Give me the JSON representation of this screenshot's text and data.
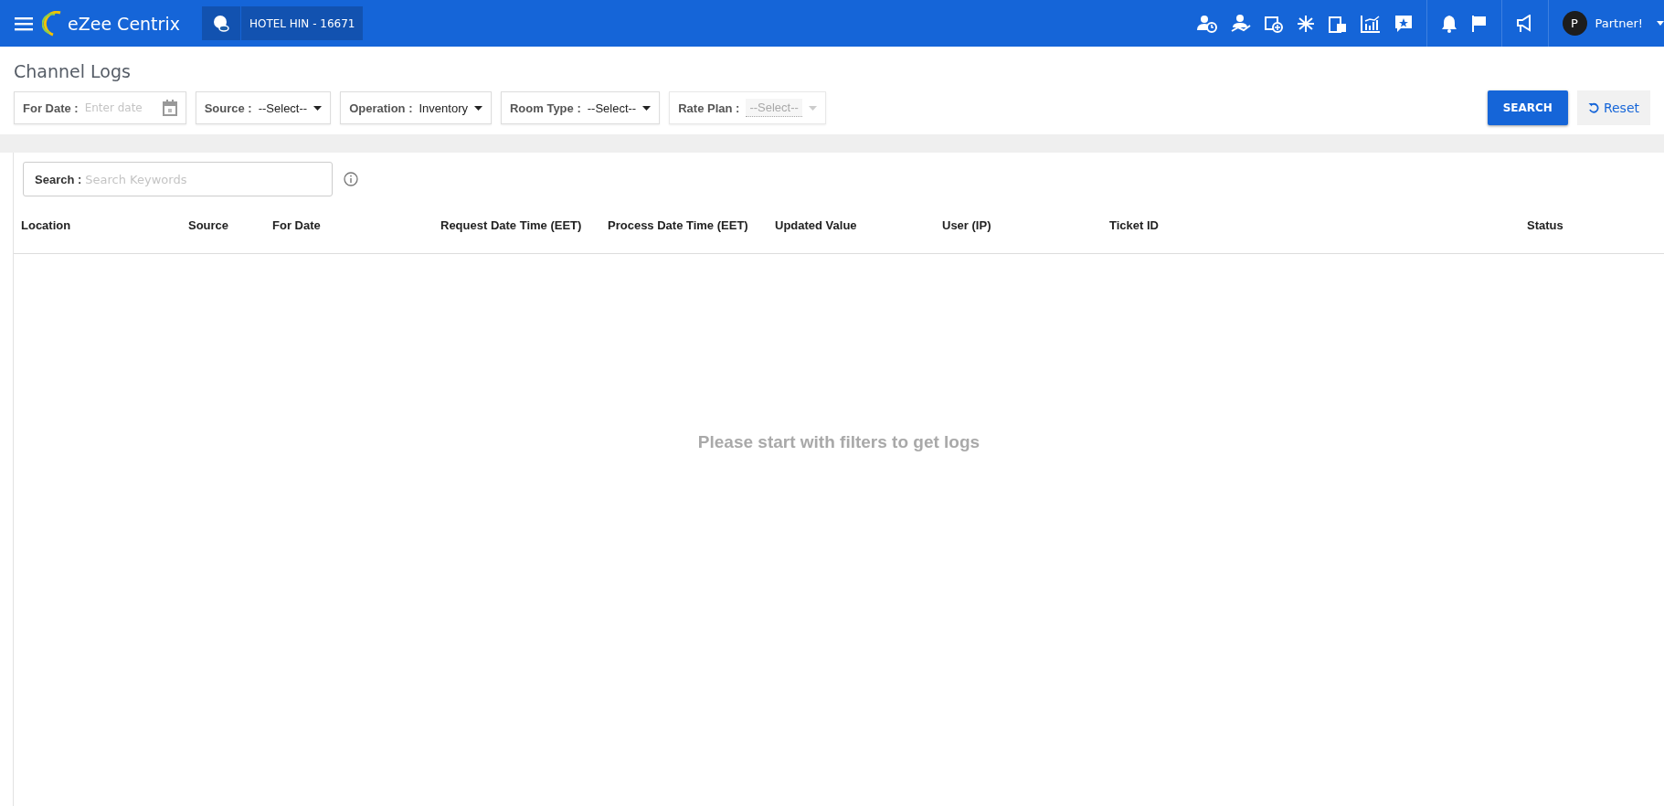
{
  "header": {
    "brand": "eZee Centrix",
    "hotel": "HOTEL HIN -  16671",
    "user": {
      "initial": "P",
      "name": "Partner!"
    }
  },
  "page_title": "Channel Logs",
  "filters": [
    {
      "kind": "date",
      "label": "For Date :",
      "placeholder": "Enter date"
    },
    {
      "kind": "select",
      "label": "Source :",
      "value": "--Select--",
      "disabled": false
    },
    {
      "kind": "select",
      "label": "Operation :",
      "value": "Inventory",
      "disabled": false
    },
    {
      "kind": "select",
      "label": "Room Type :",
      "value": "--Select--",
      "disabled": false
    },
    {
      "kind": "select",
      "label": "Rate Plan :",
      "value": "--Select--",
      "disabled": true
    }
  ],
  "buttons": {
    "search": "SEARCH",
    "reset": "Reset"
  },
  "search": {
    "label": "Search :",
    "placeholder": "Search Keywords"
  },
  "table": {
    "columns": [
      "Location",
      "Source",
      "For Date",
      "Request Date Time (EET)",
      "Process Date Time (EET)",
      "Updated Value",
      "User (IP)",
      "Ticket ID",
      "Status"
    ],
    "empty_message": "Please start with filters to get logs"
  }
}
